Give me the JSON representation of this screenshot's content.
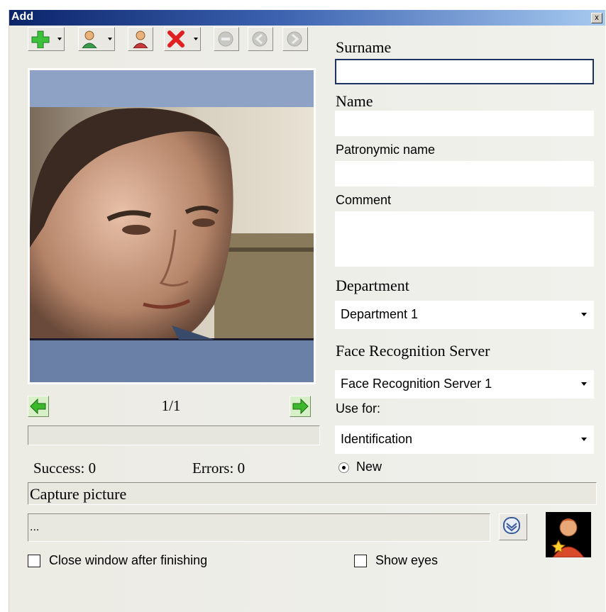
{
  "window": {
    "title": "Add",
    "close_label": "x"
  },
  "toolbar": {
    "buttons": [
      {
        "name": "add-photo-button",
        "icon": "green-plus-icon"
      },
      {
        "name": "add-person-button",
        "icon": "person-icon"
      },
      {
        "name": "person-settings-button",
        "icon": "person-card-icon"
      },
      {
        "name": "delete-button",
        "icon": "red-x-icon"
      },
      {
        "name": "minus-button",
        "icon": "minus-icon",
        "disabled": true
      },
      {
        "name": "prev-button",
        "icon": "left-circle-icon",
        "disabled": true
      },
      {
        "name": "next-button",
        "icon": "right-circle-icon",
        "disabled": true
      }
    ]
  },
  "photo": {
    "counter": "1/1"
  },
  "stats": {
    "success": "Success: 0",
    "errors": "Errors: 0"
  },
  "form": {
    "surname_label": "Surname",
    "surname_value": "",
    "name_label": "Name",
    "name_value": "",
    "patronymic_label": "Patronymic name",
    "patronymic_value": "",
    "comment_label": "Comment",
    "comment_value": "",
    "department_label": "Department",
    "department_value": "Department 1",
    "server_label": "Face Recognition Server",
    "server_value": "Face Recognition Server 1",
    "use_for_label": "Use for:",
    "use_for_value": "Identification",
    "radio_new_label": "New"
  },
  "status": {
    "capture_text": "Capture picture",
    "log_text": "..."
  },
  "options": {
    "close_after_label": "Close window after finishing",
    "close_after_checked": false,
    "show_eyes_label": "Show eyes",
    "show_eyes_checked": false
  },
  "colors": {
    "title_gradient_start": "#0b246a",
    "title_gradient_end": "#a6caf0",
    "focus_border": "#1c3260",
    "nav_arrow": "#3cb82c"
  }
}
